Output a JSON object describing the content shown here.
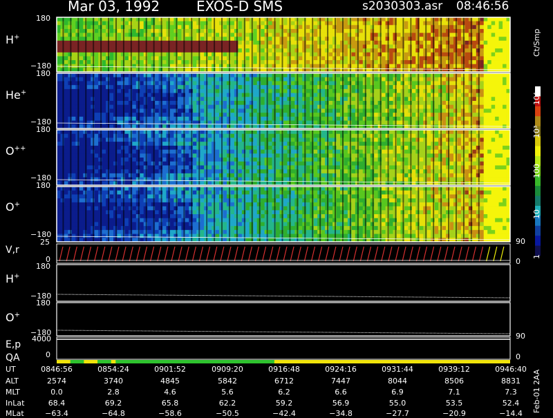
{
  "header": {
    "date": "Mar 03, 1992",
    "instrument": "EXOS-D SMS",
    "file": "s2030303.asr",
    "time": "08:46:56"
  },
  "colorbar": {
    "title": "Ct/Smp",
    "ticks": [
      {
        "label": "1",
        "value": 1
      },
      {
        "label": "10",
        "value": 10
      },
      {
        "label": "100",
        "value": 100
      },
      {
        "label": "10³",
        "value": 1000
      },
      {
        "label": "10⁴",
        "value": 10000
      }
    ]
  },
  "side_label": "Feb-01 2AA",
  "colors": {
    "H": [
      "#1a8a2a",
      "#2eb82e",
      "#5fd021",
      "#a7d316",
      "#e8e10a",
      "#c89a10",
      "#b84a10",
      "#7a2424",
      "#1f5fc4"
    ],
    "heavy": [
      "#0b1c8c",
      "#0e3fb5",
      "#1d6ed0",
      "#1fa7c9",
      "#24b68a",
      "#2fae2f",
      "#58c71f",
      "#a5d21a",
      "#e5e00a",
      "#c98f14",
      "#9a3a16"
    ],
    "colorbar": [
      "#ffffff",
      "#c01010",
      "#d84010",
      "#ae8a18",
      "#8a7a1a",
      "#d8c80a",
      "#f0f00a",
      "#b8e81a",
      "#7cd21a",
      "#38b82a",
      "#1a8a3a",
      "#157a6a",
      "#20b0b8",
      "#1878c0",
      "#1040a0",
      "#0818a0",
      "#101050"
    ],
    "qa_yellow": "#f0e30a",
    "qa_green": "#2ec22e",
    "trace": "#ffffff"
  },
  "chart_data": {
    "type": "heatmap",
    "panels": [
      {
        "label": "H",
        "sup": "+",
        "ymax": "180",
        "ymin": "−180"
      },
      {
        "label": "He",
        "sup": "+",
        "ymax": "180",
        "ymin": "−180"
      },
      {
        "label": "O",
        "sup": "++",
        "ymax": "180",
        "ymin": "−180"
      },
      {
        "label": "O",
        "sup": "+",
        "ymax": "180",
        "ymin": "−180"
      }
    ],
    "vr_panel": {
      "label": "V,r",
      "ymax": "25",
      "ymin": "0",
      "right_max": "90",
      "right_min": "0"
    },
    "line_panels": [
      {
        "label": "H",
        "sup": "+",
        "ymax": "180",
        "ymin": "−180"
      },
      {
        "label": "O",
        "sup": "+",
        "ymax": "180",
        "ymin": "−180"
      }
    ],
    "ep_panel": {
      "label": "E,p",
      "left_value": "4000",
      "right_value": "90"
    },
    "qa_panel": {
      "label": "QA",
      "left_value": "0",
      "right_value": "0",
      "green_segments": [
        [
          0.03,
          0.06
        ],
        [
          0.09,
          0.12
        ],
        [
          0.13,
          0.48
        ]
      ]
    },
    "ephemeris": {
      "row_labels": [
        "UT",
        "ALT",
        "MLT",
        "InLat",
        "MLat"
      ],
      "columns": [
        {
          "UT": "0846:56",
          "ALT": "2574",
          "MLT": "0.0",
          "InLat": "68.4",
          "MLat": "−63.4"
        },
        {
          "UT": "0854:24",
          "ALT": "3740",
          "MLT": "2.8",
          "InLat": "69.2",
          "MLat": "−64.8"
        },
        {
          "UT": "0901:52",
          "ALT": "4845",
          "MLT": "4.6",
          "InLat": "65.8",
          "MLat": "−58.6"
        },
        {
          "UT": "0909:20",
          "ALT": "5842",
          "MLT": "5.6",
          "InLat": "62.2",
          "MLat": "−50.5"
        },
        {
          "UT": "0916:48",
          "ALT": "6712",
          "MLT": "6.2",
          "InLat": "59.2",
          "MLat": "−42.4"
        },
        {
          "UT": "0924:16",
          "ALT": "7447",
          "MLT": "6.6",
          "InLat": "56.9",
          "MLat": "−34.8"
        },
        {
          "UT": "0931:44",
          "ALT": "8044",
          "MLT": "6.9",
          "InLat": "55.0",
          "MLat": "−27.7"
        },
        {
          "UT": "0939:12",
          "ALT": "8506",
          "MLT": "7.1",
          "InLat": "53.5",
          "MLat": "−20.9"
        },
        {
          "UT": "0946:40",
          "ALT": "8831",
          "MLT": "7.3",
          "InLat": "52.4",
          "MLat": "−14.4"
        }
      ]
    }
  }
}
